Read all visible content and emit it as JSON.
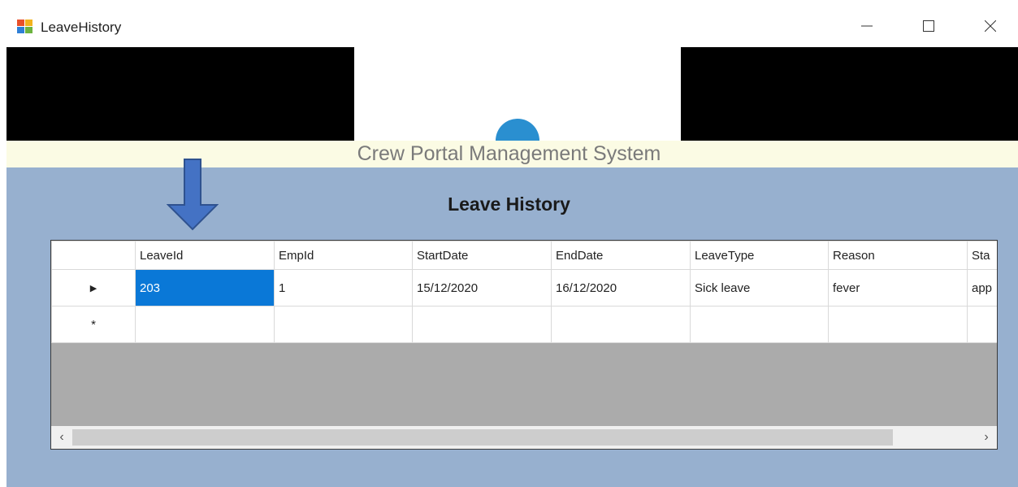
{
  "window": {
    "title": "LeaveHistory",
    "minimize_icon": "minimize-icon",
    "maximize_icon": "maximize-icon",
    "close_icon": "close-icon"
  },
  "banner": {
    "system_title": "Crew Portal Management System"
  },
  "page": {
    "heading": "Leave History"
  },
  "grid": {
    "columns": [
      "LeaveId",
      "EmpId",
      "StartDate",
      "EndDate",
      "LeaveType",
      "Reason",
      "Sta"
    ],
    "rows": [
      {
        "indicator": "▶",
        "cells": [
          "203",
          "1",
          "15/12/2020",
          "16/12/2020",
          "Sick leave",
          "fever",
          "app"
        ],
        "selected_col": 0
      },
      {
        "indicator": "*",
        "cells": [
          "",
          "",
          "",
          "",
          "",
          "",
          ""
        ]
      }
    ],
    "scroll_left": "‹",
    "scroll_right": "›"
  },
  "colors": {
    "panel": "#97b0cf",
    "header_strip": "#fbfbe4",
    "selection": "#0a78d7",
    "arrow": "#4472c4",
    "logo": "#2a8fd0"
  }
}
